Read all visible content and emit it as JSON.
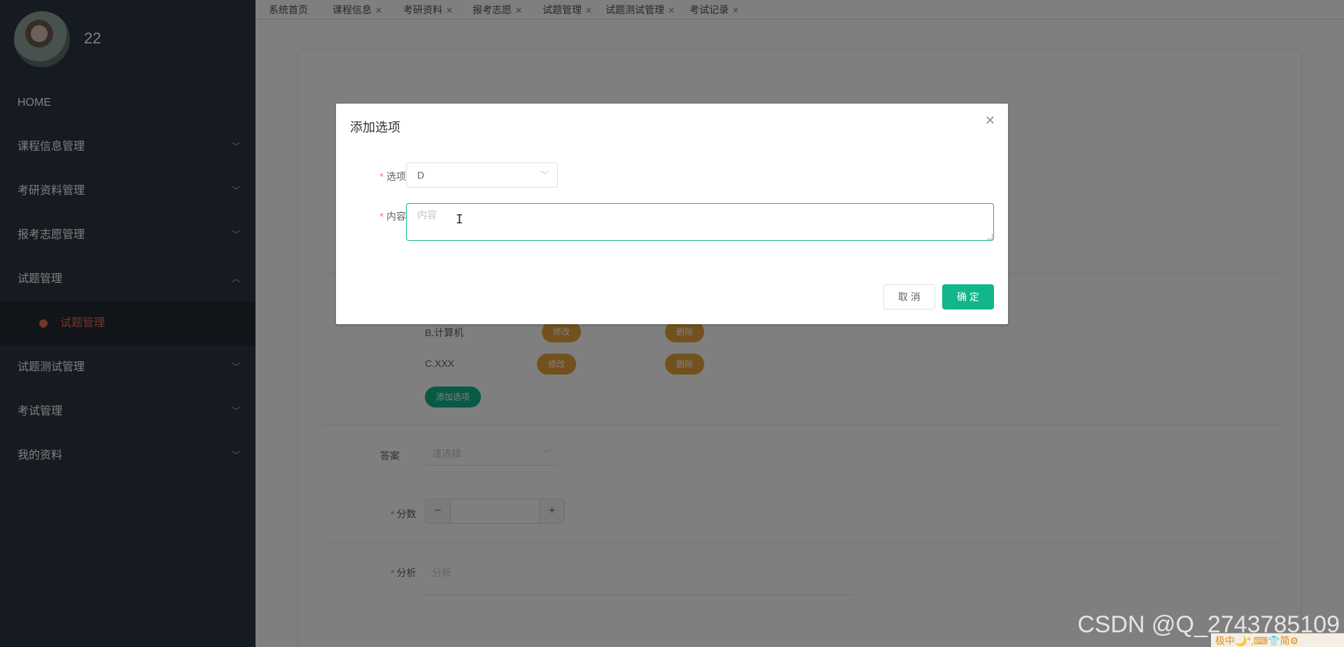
{
  "sidebar": {
    "username": "22",
    "home": "HOME",
    "items": [
      {
        "label": "课程信息管理"
      },
      {
        "label": "考研资料管理"
      },
      {
        "label": "报考志愿管理"
      },
      {
        "label": "试题管理"
      },
      {
        "label": "试题测试管理"
      },
      {
        "label": "考试管理"
      },
      {
        "label": "我的资料"
      }
    ],
    "submenu_active": "试题管理"
  },
  "tabs": [
    {
      "label": "系统首页"
    },
    {
      "label": "课程信息"
    },
    {
      "label": "考研资料"
    },
    {
      "label": "报考志愿"
    },
    {
      "label": "试题管理"
    },
    {
      "label": "试题测试管理"
    },
    {
      "label": "考试记录"
    }
  ],
  "form": {
    "options": [
      {
        "text": "B.计算机",
        "edit": "修改",
        "delete": "删除"
      },
      {
        "text": "C.XXX",
        "edit": "修改",
        "delete": "删除"
      }
    ],
    "add_option": "添加选项",
    "answer_label": "答案",
    "answer_placeholder": "请选择",
    "score_label": "分数",
    "analysis_label": "分析",
    "analysis_placeholder": "分析"
  },
  "dialog": {
    "title": "添加选项",
    "option_label": "选项",
    "option_value": "D",
    "content_label": "内容",
    "content_placeholder": "内容",
    "cancel": "取 消",
    "confirm": "确 定"
  },
  "watermark": "CSDN @Q_2743785109",
  "ime_bar": "极中🌙°,⌨👕简⚙",
  "colors": {
    "sidebar_bg": "#2b3643",
    "accent": "#13b58b",
    "warning": "#e6a23c",
    "danger": "#f56c6c"
  }
}
